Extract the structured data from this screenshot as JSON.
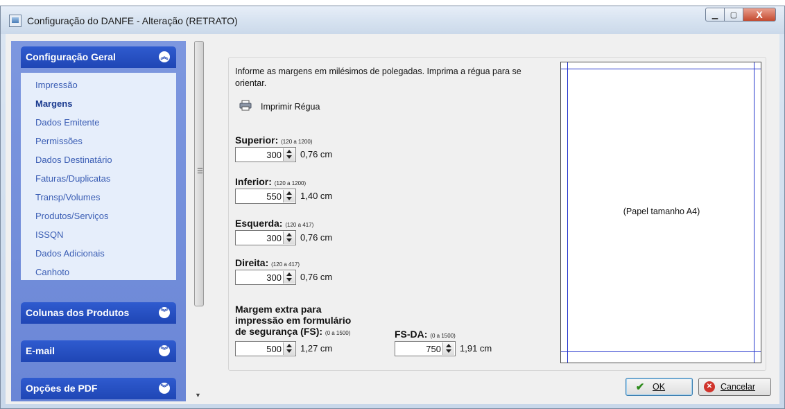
{
  "window": {
    "title": "Configuração do DANFE - Alteração  (RETRATO)",
    "close_glyph": "X"
  },
  "sidebar": {
    "groups": [
      {
        "label": "Configuração Geral",
        "state": "expanded"
      },
      {
        "label": "Colunas dos Produtos",
        "state": "collapsed"
      },
      {
        "label": "E-mail",
        "state": "collapsed"
      },
      {
        "label": "Opções de PDF",
        "state": "collapsed"
      }
    ],
    "items": [
      "Impressão",
      "Margens",
      "Dados Emitente",
      "Permissões",
      "Dados Destinatário",
      "Faturas/Duplicatas",
      "Transp/Volumes",
      "Produtos/Serviços",
      "ISSQN",
      "Dados Adicionais",
      "Canhoto"
    ],
    "active_item": "Margens"
  },
  "main": {
    "info": "Informe as margens em milésimos de polegadas. Imprima a régua para se orientar.",
    "print_ruler": "Imprimir Régua",
    "fields": {
      "superior": {
        "label": "Superior:",
        "range": "(120 a 1200)",
        "value": "300",
        "cm": "0,76 cm"
      },
      "inferior": {
        "label": "Inferior:",
        "range": "(120 a 1200)",
        "value": "550",
        "cm": "1,40 cm"
      },
      "esquerda": {
        "label": "Esquerda:",
        "range": "(120 a 417)",
        "value": "300",
        "cm": "0,76 cm"
      },
      "direita": {
        "label": "Direita:",
        "range": "(120 a 417)",
        "value": "300",
        "cm": "0,76 cm"
      }
    },
    "extra": {
      "label_line1": "Margem extra para",
      "label_line2": "impressão em formulário",
      "label_line3": "de segurança (FS):",
      "range": "(0 a 1500)",
      "value": "500",
      "cm": "1,27 cm"
    },
    "fsda": {
      "label": "FS-DA:",
      "range": "(0 a 1500)",
      "value": "750",
      "cm": "1,91 cm"
    },
    "preview_label": "(Papel tamanho A4)"
  },
  "buttons": {
    "ok": "OK",
    "cancel": "Cancelar"
  },
  "colors": {
    "sidebar_header": "#2f5bcf",
    "sidebar_bg": "#7d97df",
    "items_bg": "#e6eefb",
    "margin_line": "#2233cc"
  },
  "icons": [
    "window-app-icon",
    "printer-icon",
    "checkmark-icon",
    "cancel-icon",
    "chevron-up-icon",
    "chevron-down-icon"
  ]
}
